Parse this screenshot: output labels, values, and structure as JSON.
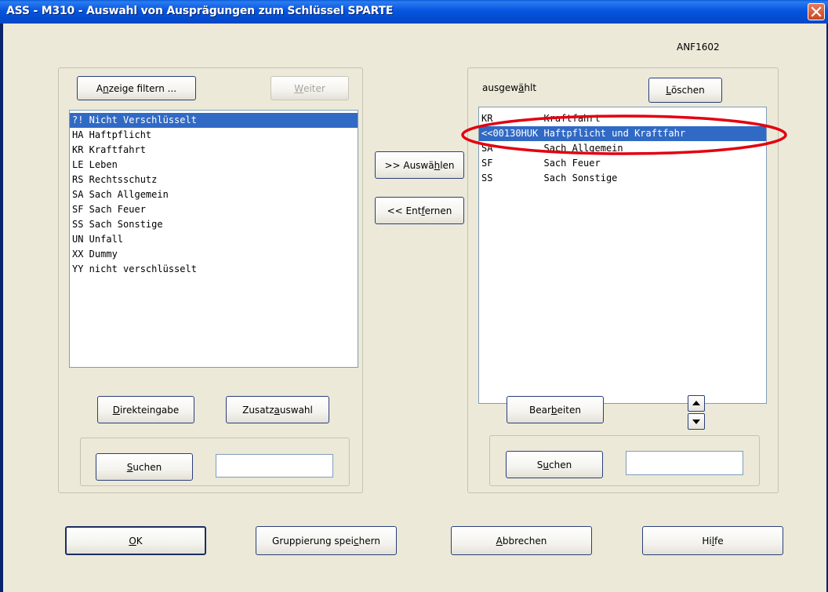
{
  "window": {
    "title": "ASS - M310 - Auswahl von Ausprägungen zum Schlüssel SPARTE",
    "form_id": "ANF1602"
  },
  "left_panel": {
    "filter_button": {
      "pre": "A",
      "u": "n",
      "post": "zeige filtern ..."
    },
    "next_button": {
      "pre": "",
      "u": "W",
      "post": "eiter"
    },
    "items": [
      "?! Nicht Verschlüsselt",
      "HA Haftpflicht",
      "KR Kraftfahrt",
      "LE Leben",
      "RS Rechtsschutz",
      "SA Sach Allgemein",
      "SF Sach Feuer",
      "SS Sach Sonstige",
      "UN Unfall",
      "XX Dummy",
      "YY nicht verschlüsselt"
    ],
    "selected_index": 0,
    "direct_input_button": {
      "pre": "",
      "u": "D",
      "post": "irekteingabe"
    },
    "extra_select_button": {
      "pre": "Zusatz",
      "u": "a",
      "post": "uswahl"
    },
    "search_button": {
      "pre": "",
      "u": "S",
      "post": "uchen"
    },
    "search_value": ""
  },
  "middle": {
    "select_button": {
      "pre": ">> Auswä",
      "u": "h",
      "post": "len"
    },
    "remove_button": {
      "pre": "<< Ent",
      "u": "f",
      "post": "ernen"
    }
  },
  "right_panel": {
    "label": {
      "pre": "ausgew",
      "u": "ä",
      "post": "hlt"
    },
    "delete_button": {
      "pre": "",
      "u": "L",
      "post": "öschen"
    },
    "items": [
      "KR         Kraftfahrt",
      "<<00130HUK Haftpflicht und Kraftfahr",
      "SA         Sach Allgemein",
      "SF         Sach Feuer",
      "SS         Sach Sonstige"
    ],
    "selected_index": 1,
    "edit_button": {
      "pre": "Bear",
      "u": "b",
      "post": "eiten"
    },
    "search_button": {
      "pre": "S",
      "u": "u",
      "post": "chen"
    },
    "search_value": ""
  },
  "footer": {
    "ok_button": {
      "pre": "",
      "u": "O",
      "post": "K"
    },
    "save_group_button": {
      "pre": "Gruppierung spei",
      "u": "c",
      "post": "hern"
    },
    "cancel_button": {
      "pre": "",
      "u": "A",
      "post": "bbrechen"
    },
    "help_button": {
      "pre": "Hi",
      "u": "l",
      "post": "fe"
    }
  },
  "annotation": {
    "color": "#e3000f",
    "shape": "ellipse"
  },
  "colors": {
    "titlebar": "#0555e0",
    "dialog_bg": "#ece9d8",
    "selection": "#316ac5"
  }
}
